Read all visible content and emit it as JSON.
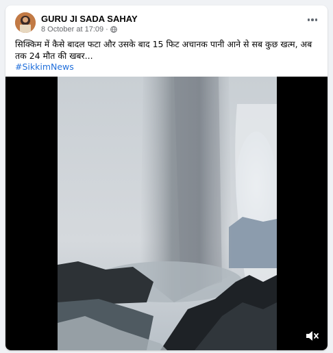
{
  "post": {
    "author": "GURU JI SADA SAHAY",
    "timestamp": "8 October at 17:09",
    "separator": "·",
    "privacy_icon": "globe-icon",
    "text": "सिक्किम में कैसे बादल फटा और उसके बाद 15 फिट अचानक पानी आने से सब कुछ खत्म, अब तक 24 मौत की खबर...",
    "hashtag": "#SikkimNews"
  },
  "video": {
    "volume_icon": "speaker-muted-icon"
  },
  "colors": {
    "link": "#216fdb",
    "secondary_text": "#65676b",
    "background": "#f0f2f5"
  }
}
